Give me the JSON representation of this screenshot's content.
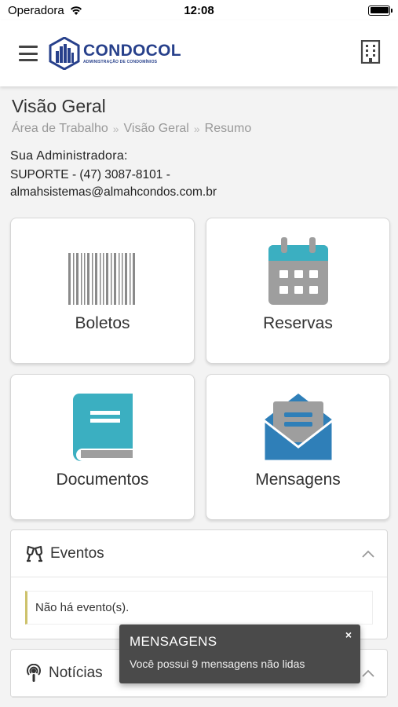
{
  "status_bar": {
    "carrier": "Operadora",
    "time": "12:08"
  },
  "app_bar": {
    "logo_title": "CONDOCOL",
    "logo_subtitle": "ADMINISTRAÇÃO DE CONDOMÍNIOS",
    "menu_icon": "hamburger-menu-icon",
    "building_icon": "building-icon"
  },
  "page": {
    "title": "Visão Geral",
    "breadcrumb": [
      "Área de Trabalho",
      "Visão Geral",
      "Resumo"
    ],
    "admin_label": "Sua Administradora:",
    "admin_line1": "SUPORTE - (47) 3087-8101 -",
    "admin_line2": "almahsistemas@almahcondos.com.br"
  },
  "tiles": [
    {
      "label": "Boletos",
      "icon": "barcode-icon"
    },
    {
      "label": "Reservas",
      "icon": "calendar-icon"
    },
    {
      "label": "Documentos",
      "icon": "book-icon"
    },
    {
      "label": "Mensagens",
      "icon": "open-envelope-icon"
    }
  ],
  "events_panel": {
    "title": "Eventos",
    "icon": "cheers-icon",
    "empty_text": "Não há evento(s)."
  },
  "news_panel": {
    "title": "Notícias",
    "icon": "podcast-icon"
  },
  "toast": {
    "title": "MENSAGENS",
    "message": "Você possui 9 mensagens não lidas",
    "close": "×"
  },
  "colors": {
    "brand": "#27408b",
    "calendar_accent": "#3bafc1",
    "book": "#3bafc1",
    "envelope": "#2f7fb8",
    "toast_bg": "#4a4a4a"
  }
}
